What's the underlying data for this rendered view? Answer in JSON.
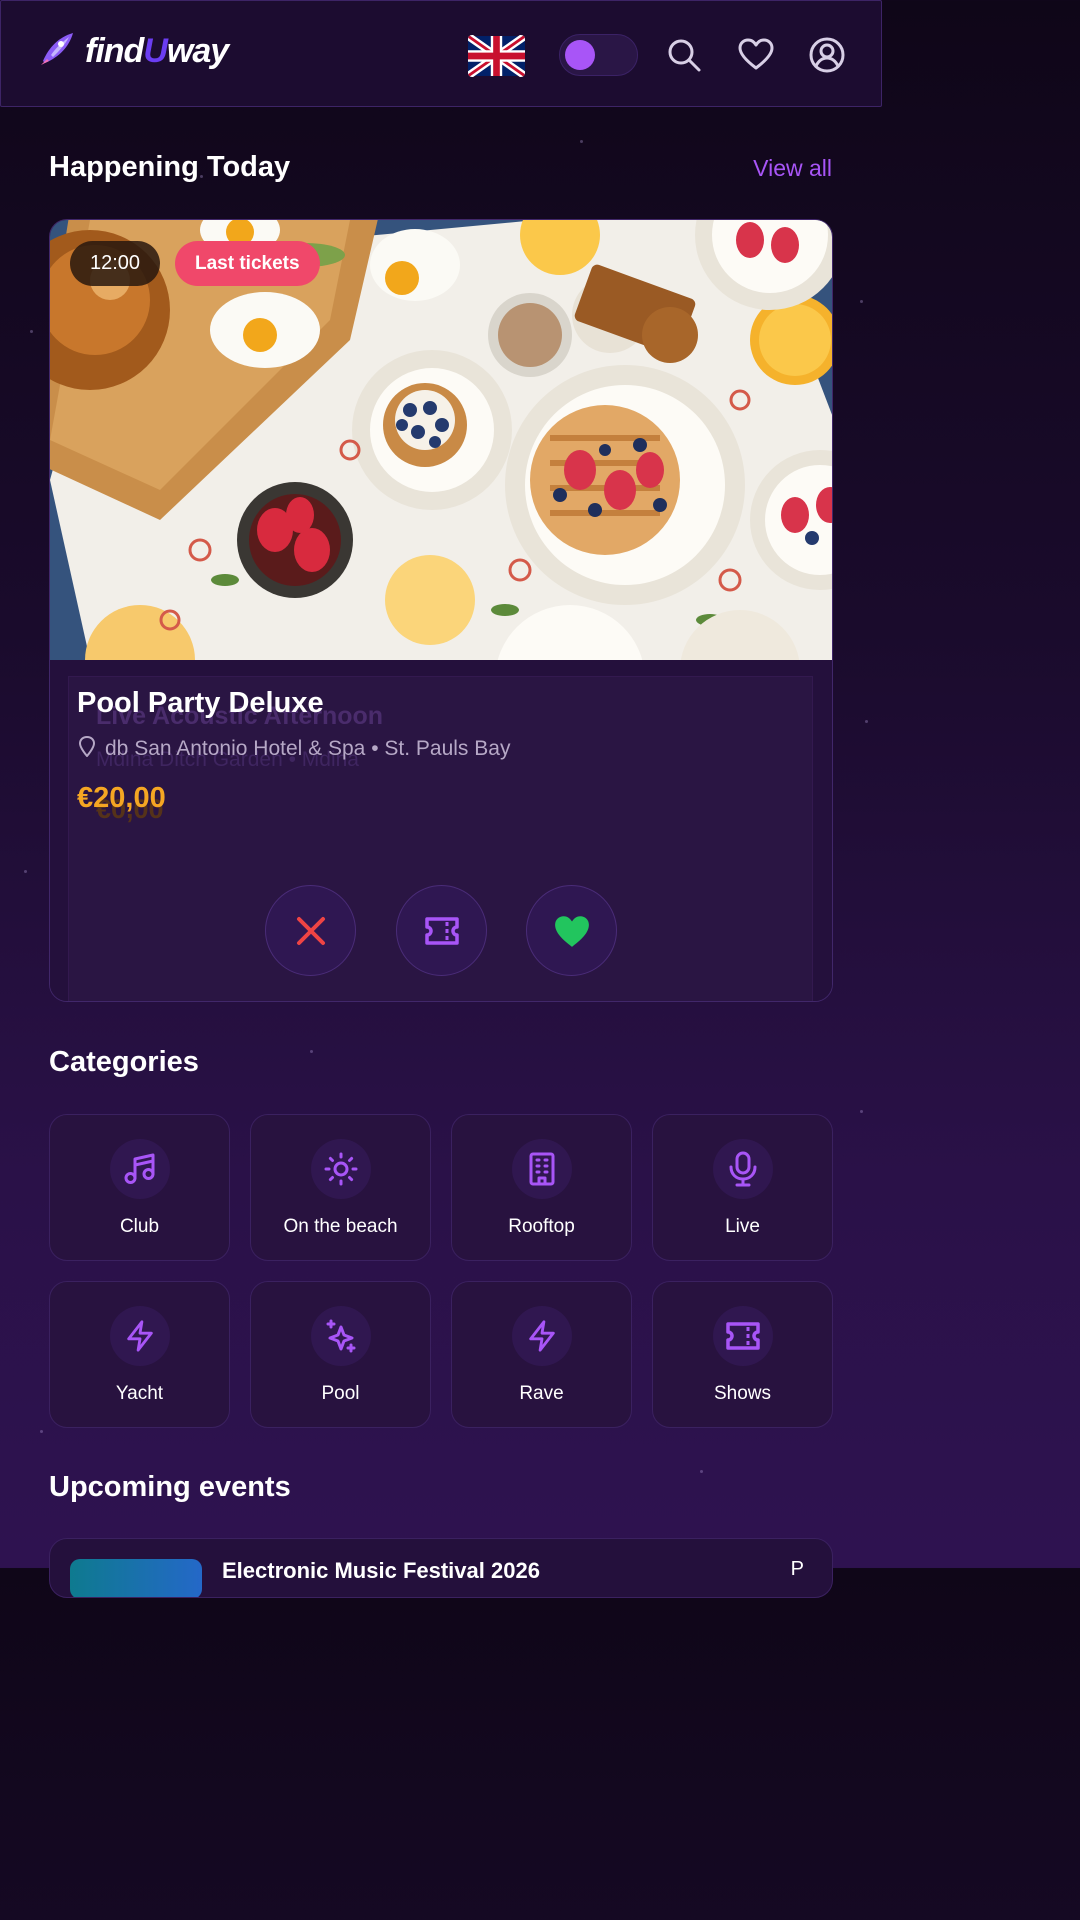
{
  "header": {
    "logo_text_1": "find",
    "logo_text_u": "U",
    "logo_text_2": "way",
    "language": "English (UK flag)",
    "icons": [
      "rocket-icon",
      "uk-flag-icon",
      "search-icon",
      "heart-icon",
      "user-icon"
    ]
  },
  "happening_today": {
    "title": "Happening Today",
    "view_all": "View all"
  },
  "featured_event": {
    "time": "12:00",
    "badge": "Last tickets",
    "title": "Pool Party Deluxe",
    "location": "db San Antonio Hotel & Spa • St. Pauls Bay",
    "price": "€20,00"
  },
  "ghost_event": {
    "title": "Live Acoustic Afternoon",
    "location": "Mdina Ditch Garden • Mdina",
    "price": "€0,00"
  },
  "categories": {
    "title": "Categories",
    "items": [
      {
        "label": "Club",
        "icon": "music-note-icon"
      },
      {
        "label": "On the beach",
        "icon": "sun-icon"
      },
      {
        "label": "Rooftop",
        "icon": "building-icon"
      },
      {
        "label": "Live",
        "icon": "microphone-icon"
      },
      {
        "label": "Yacht",
        "icon": "lightning-icon"
      },
      {
        "label": "Pool",
        "icon": "sparkles-icon"
      },
      {
        "label": "Rave",
        "icon": "lightning-icon"
      },
      {
        "label": "Shows",
        "icon": "ticket-icon"
      }
    ]
  },
  "upcoming": {
    "title": "Upcoming events",
    "first_item_title": "Electronic Music Festival 2026",
    "first_item_right": "P"
  },
  "colors": {
    "accent": "#a855f7",
    "price": "#f5a623",
    "badge": "#f0486a",
    "dislike": "#ef4444",
    "like": "#22c55e"
  }
}
